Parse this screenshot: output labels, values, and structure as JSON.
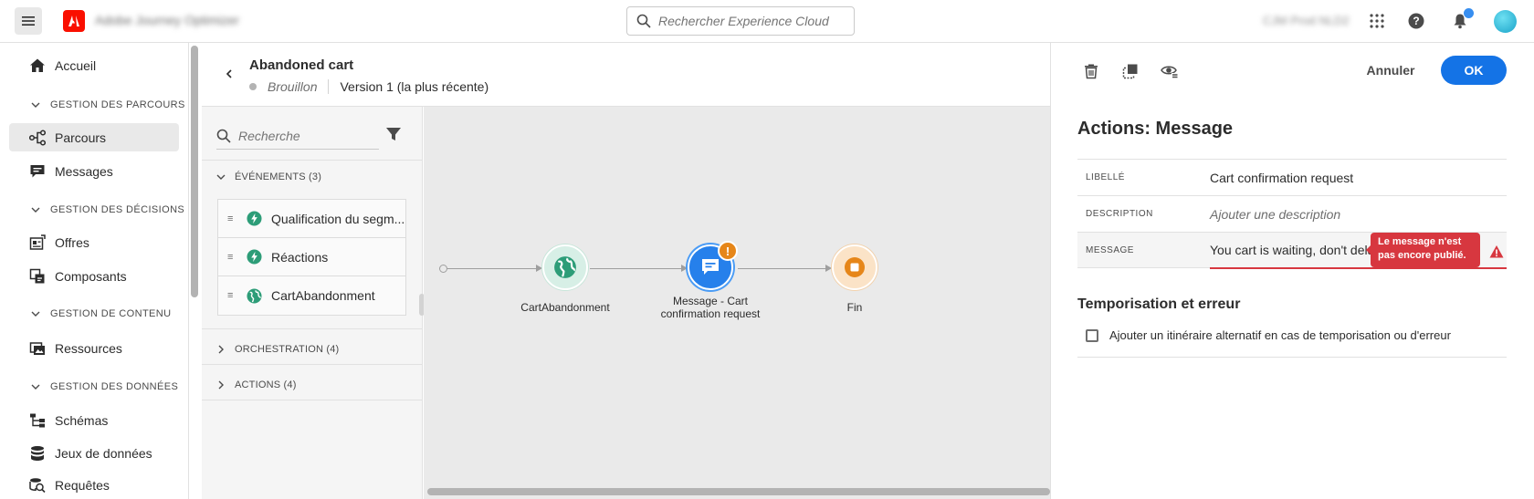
{
  "topbar": {
    "app_name": "Adobe Journey Optimizer",
    "search_placeholder": "Rechercher Experience Cloud",
    "org_name": "CJM Prod NLD2"
  },
  "nav": {
    "items": [
      {
        "label": "Accueil"
      },
      {
        "section": "GESTION DES PARCOURS"
      },
      {
        "label": "Parcours",
        "active": true
      },
      {
        "label": "Messages"
      },
      {
        "section": "GESTION DES DÉCISIONS"
      },
      {
        "label": "Offres"
      },
      {
        "label": "Composants"
      },
      {
        "section": "GESTION DE CONTENU"
      },
      {
        "label": "Ressources"
      },
      {
        "section": "GESTION DES DONNÉES"
      },
      {
        "label": "Schémas"
      },
      {
        "label": "Jeux de données"
      },
      {
        "label": "Requêtes"
      }
    ]
  },
  "journey": {
    "title": "Abandoned cart",
    "status": "Brouillon",
    "version": "Version 1 (la plus récente)"
  },
  "palette": {
    "search_placeholder": "Recherche",
    "events_label": "ÉVÉNEMENTS (3)",
    "events": [
      "Qualification du segm...",
      "Réactions",
      "CartAbandonment"
    ],
    "orchestration_label": "ORCHESTRATION (4)",
    "actions_label": "ACTIONS (4)"
  },
  "canvas": {
    "nodes": [
      {
        "label": "CartAbandonment"
      },
      {
        "label_line1": "Message - Cart",
        "label_line2": "confirmation request",
        "badge": "!"
      },
      {
        "label": "Fin"
      }
    ]
  },
  "panel": {
    "cancel_label": "Annuler",
    "ok_label": "OK",
    "title": "Actions: Message",
    "props": {
      "label_key": "LIBELLÉ",
      "label_value": "Cart confirmation request",
      "description_key": "DESCRIPTION",
      "description_placeholder": "Ajouter une description",
      "message_key": "MESSAGE",
      "message_value": "You cart is waiting, don't delay"
    },
    "tooltip": "Le message n'est pas encore publié.",
    "section_title": "Temporisation et erreur",
    "checkbox_label": "Ajouter un itinéraire alternatif en cas de temporisation ou d'erreur"
  },
  "colors": {
    "accent": "#1473e6",
    "error": "#d7373f",
    "warning": "#e68619",
    "event_green": "#2d9d78",
    "end_orange": "#e68619"
  }
}
